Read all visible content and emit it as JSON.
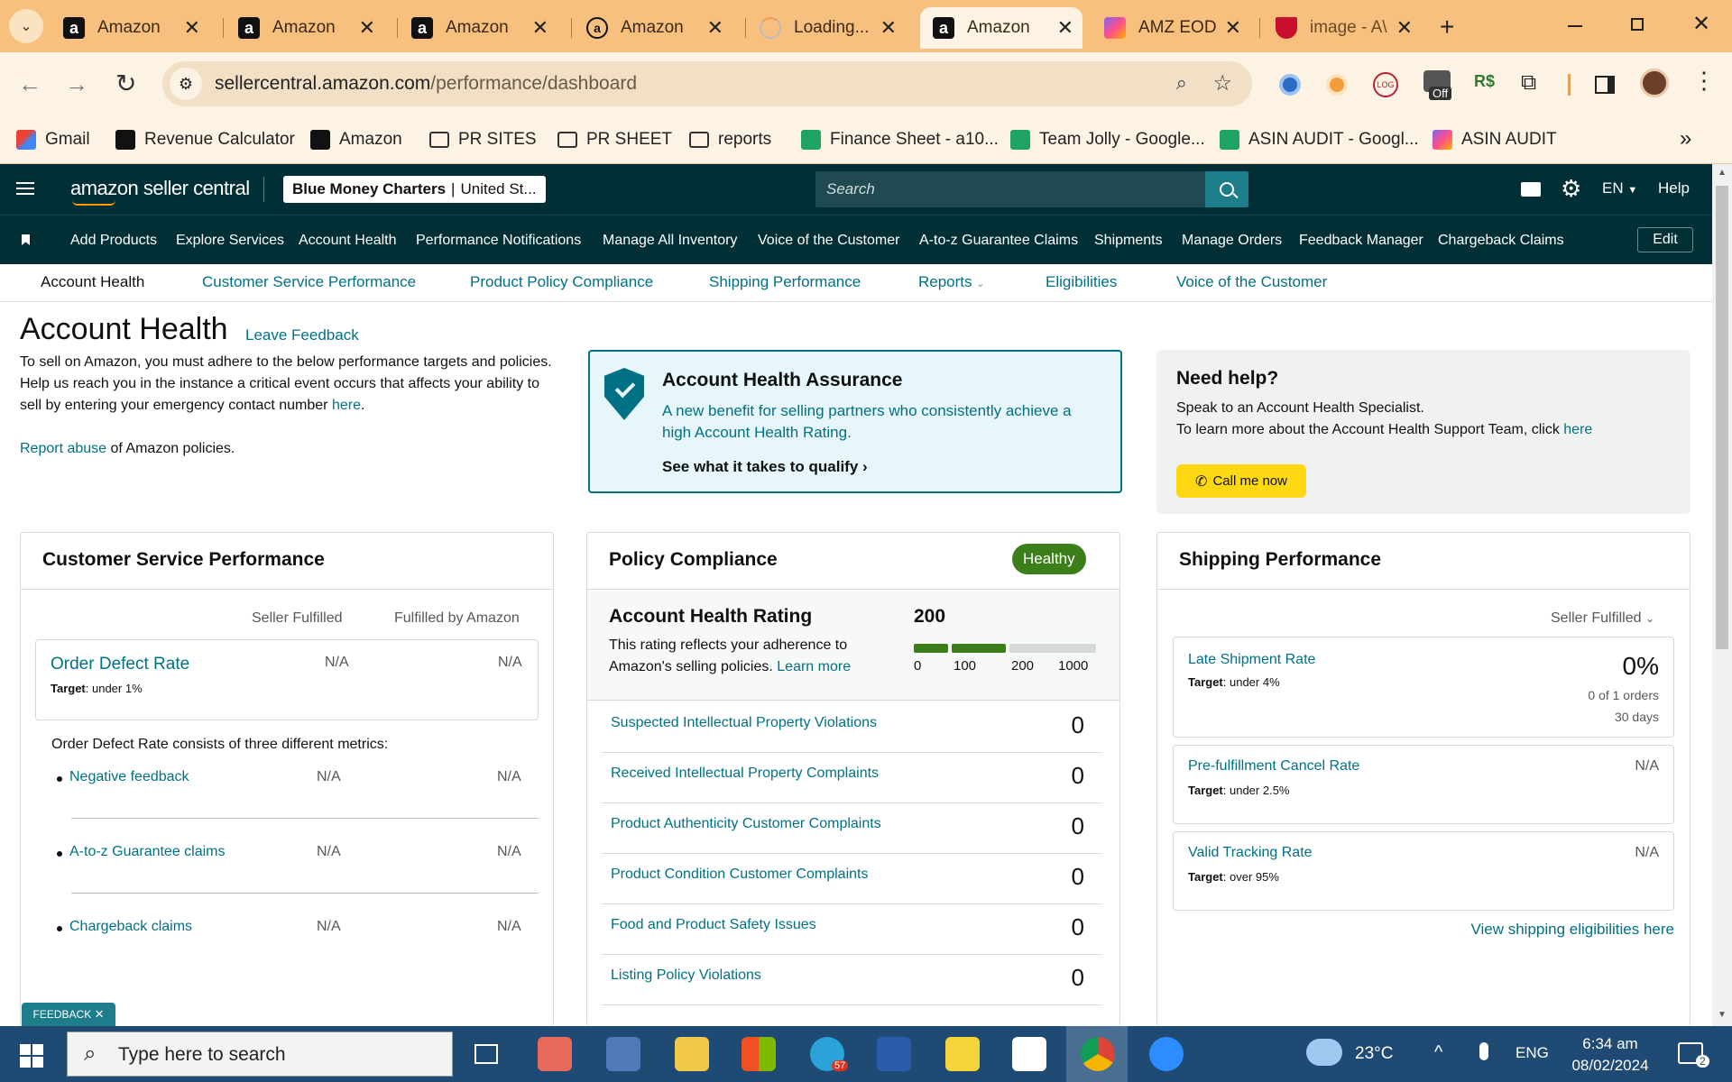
{
  "browser": {
    "tabs": [
      {
        "title": "Amazon",
        "icon": "amazon-icon"
      },
      {
        "title": "Amazon",
        "icon": "amazon-icon"
      },
      {
        "title": "Amazon",
        "icon": "amazon-icon"
      },
      {
        "title": "Amazon",
        "icon": "amazon-icon"
      },
      {
        "title": "Loading...",
        "icon": "loading-icon"
      },
      {
        "title": "Amazon",
        "icon": "amazon-icon"
      },
      {
        "title": "AMZ EOD",
        "icon": "clickup-icon"
      },
      {
        "title": "image - A\\",
        "icon": "image-icon"
      }
    ],
    "url_host": "sellercentral.amazon.com",
    "url_path": "/performance/dashboard",
    "extension_badge": "Off",
    "bookmarks": [
      {
        "label": "Gmail",
        "icon": "gmail-icon"
      },
      {
        "label": "Revenue Calculator",
        "icon": "amazon-icon"
      },
      {
        "label": "Amazon",
        "icon": "amazon-icon"
      },
      {
        "label": "PR SITES",
        "icon": "folder-icon"
      },
      {
        "label": "PR SHEET",
        "icon": "folder-icon"
      },
      {
        "label": "reports",
        "icon": "folder-icon"
      },
      {
        "label": "Finance Sheet - a10...",
        "icon": "sheets-icon"
      },
      {
        "label": "Team Jolly - Google...",
        "icon": "sheets-icon"
      },
      {
        "label": "ASIN AUDIT - Googl...",
        "icon": "sheets-icon"
      },
      {
        "label": "ASIN AUDIT",
        "icon": "clickup-icon"
      }
    ]
  },
  "seller_central": {
    "logo": "amazon seller central",
    "account_name": "Blue Money Charters",
    "account_region": "United St...",
    "search_placeholder": "Search",
    "language": "EN",
    "help": "Help",
    "nav_items": [
      "Add Products",
      "Explore Services",
      "Account Health",
      "Performance Notifications",
      "Manage All Inventory",
      "Voice of the Customer",
      "A-to-z Guarantee Claims",
      "Shipments",
      "Manage Orders",
      "Feedback Manager",
      "Chargeback Claims"
    ],
    "edit": "Edit",
    "sub_nav": [
      "Account Health",
      "Customer Service Performance",
      "Product Policy Compliance",
      "Shipping Performance",
      "Reports",
      "Eligibilities",
      "Voice of the Customer"
    ]
  },
  "page": {
    "title": "Account Health",
    "leave_feedback": "Leave Feedback",
    "intro1": "To sell on Amazon, you must adhere to the below performance targets and policies.",
    "intro2_pre": "Help us reach you in the instance a critical event occurs that affects your ability to sell by entering your emergency contact number ",
    "intro2_link": "here",
    "intro2_post": ".",
    "report_abuse_link": "Report abuse",
    "report_abuse_rest": " of Amazon policies."
  },
  "assurance": {
    "title": "Account Health Assurance",
    "text": "A new benefit for selling partners who consistently achieve a high Account Health Rating.",
    "cta": "See what it takes to qualify"
  },
  "help_box": {
    "title": "Need help?",
    "line1": "Speak to an Account Health Specialist.",
    "line2": "To learn more about the Account Health Support Team, click ",
    "link": "here",
    "button": "Call me now"
  },
  "customer_service": {
    "title": "Customer Service Performance",
    "col1": "Seller Fulfilled",
    "col2": "Fulfilled by Amazon",
    "odr_label": "Order Defect Rate",
    "odr_target_label": "Target",
    "odr_target": ": under 1%",
    "odr_v1": "N/A",
    "odr_v2": "N/A",
    "consists": "Order Defect Rate consists of three different metrics:",
    "metrics": [
      {
        "label": "Negative feedback",
        "v1": "N/A",
        "v2": "N/A"
      },
      {
        "label": "A-to-z Guarantee claims",
        "v1": "N/A",
        "v2": "N/A"
      },
      {
        "label": "Chargeback claims",
        "v1": "N/A",
        "v2": "N/A"
      }
    ],
    "feedback_tab": "FEEDBACK"
  },
  "policy": {
    "title": "Policy Compliance",
    "status": "Healthy",
    "rating_title": "Account Health Rating",
    "rating_value": "200",
    "rating_text": "This rating reflects your adherence to Amazon's selling policies.",
    "learn_more": "Learn more",
    "scale": [
      "0",
      "100",
      "200",
      "1000"
    ],
    "rows": [
      {
        "label": "Suspected Intellectual Property Violations",
        "value": "0"
      },
      {
        "label": "Received Intellectual Property Complaints",
        "value": "0"
      },
      {
        "label": "Product Authenticity Customer Complaints",
        "value": "0"
      },
      {
        "label": "Product Condition Customer Complaints",
        "value": "0"
      },
      {
        "label": "Food and Product Safety Issues",
        "value": "0"
      },
      {
        "label": "Listing Policy Violations",
        "value": "0"
      }
    ]
  },
  "shipping": {
    "title": "Shipping Performance",
    "filter": "Seller Fulfilled",
    "rows": [
      {
        "label": "Late Shipment Rate",
        "target": ": under 4%",
        "value": "0%",
        "sub1": "0 of 1 orders",
        "sub2": "30 days"
      },
      {
        "label": "Pre-fulfillment Cancel Rate",
        "target": ": under 2.5%",
        "value": "N/A"
      },
      {
        "label": "Valid Tracking Rate",
        "target": ": over 95%",
        "value": "N/A"
      }
    ],
    "target_label": "Target",
    "eligibilities_link": "View shipping eligibilities here"
  },
  "taskbar": {
    "search_placeholder": "Type here to search",
    "telegram_badge": "57",
    "temperature": "23°C",
    "language": "ENG",
    "time": "6:34 am",
    "date": "08/02/2024",
    "notifications": "2"
  },
  "colors": {
    "sc_dark": "#002f36",
    "link": "#007185",
    "healthy": "#3b7e1a",
    "call_button": "#ffd814",
    "browser_frame": "#f7c07f"
  }
}
